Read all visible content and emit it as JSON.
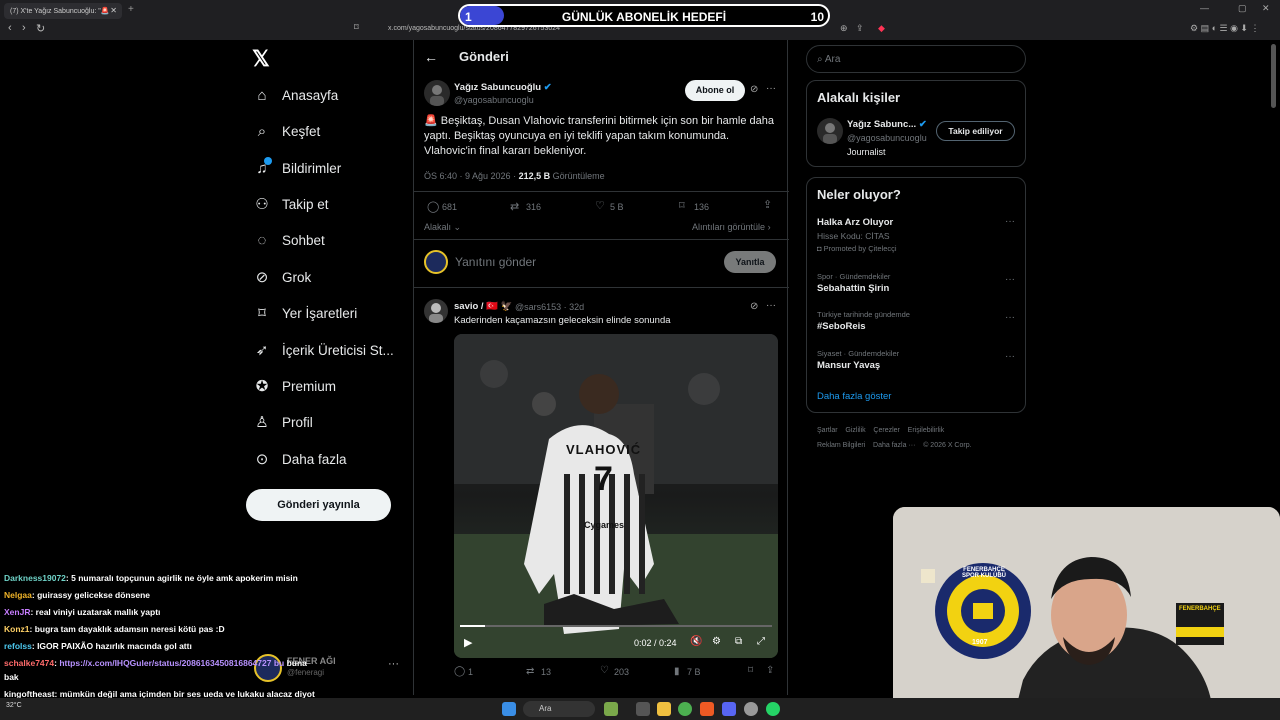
{
  "browser": {
    "tab_title": "(7) X'te Yağız Sabuncuoğlu: \"🚨",
    "url": "x.com/yagosabuncuoglu/status/2086477829726753024"
  },
  "overlay": {
    "goal_current": "1",
    "goal_title": "GÜNLÜK ABONELİK HEDEFİ",
    "goal_target": "10",
    "goal_progress": 0.1
  },
  "sidebar": {
    "items": [
      {
        "label": "Anasayfa",
        "icon": "home-icon"
      },
      {
        "label": "Keşfet",
        "icon": "search-icon"
      },
      {
        "label": "Bildirimler",
        "icon": "bell-icon"
      },
      {
        "label": "Takip et",
        "icon": "follow-icon"
      },
      {
        "label": "Sohbet",
        "icon": "chat-icon"
      },
      {
        "label": "Grok",
        "icon": "grok-icon"
      },
      {
        "label": "Yer İşaretleri",
        "icon": "bookmark-icon"
      },
      {
        "label": "İçerik Üreticisi St...",
        "icon": "rocket-icon"
      },
      {
        "label": "Premium",
        "icon": "verified-icon"
      },
      {
        "label": "Profil",
        "icon": "person-icon"
      },
      {
        "label": "Daha fazla",
        "icon": "more-icon"
      }
    ],
    "post_button": "Gönderi yayınla",
    "account_name": "FENER AĞI",
    "account_handle": "@feneragi"
  },
  "main": {
    "header": "Gönderi",
    "tweet": {
      "name": "Yağız Sabuncuoğlu",
      "handle": "@yagosabuncuoglu",
      "follow": "Abone ol",
      "text": "🚨 Beşiktaş, Dusan Vlahovic transferini bitirmek için son bir hamle daha yaptı. Beşiktaş oyuncuya en iyi teklifi yapan takım konumunda. Vlahovic'in final kararı bekleniyor.",
      "time": "ÖS 6:40 · 9 Ağu 2026 ·",
      "views": "212,5 B",
      "views_label": "Görüntüleme",
      "replies": "681",
      "reposts": "316",
      "likes": "5 B",
      "bookmarks": "136",
      "sort": "Alakalı",
      "quotes": "Alıntıları görüntüle"
    },
    "reply_box": {
      "placeholder": "Yanıtını gönder",
      "button": "Yanıtla"
    },
    "reply": {
      "name": "savio / 🇹🇷 🦅",
      "handle": "@sars6153 · 32d",
      "text": "Kaderinden kaçamazsın geleceksin elinde sonunda",
      "jersey_name": "VLAHOVIĆ",
      "jersey_number": "7",
      "sponsor": "Cygames",
      "video_time": "0:02 / 0:24",
      "video_progress": 0.08,
      "replies": "1",
      "reposts": "13",
      "likes": "203",
      "views": "7 B"
    }
  },
  "right": {
    "search_placeholder": "Ara",
    "related_title": "Alakalı kişiler",
    "person": {
      "name": "Yağız Sabunc...",
      "handle": "@yagosabuncuoglu",
      "bio": "Journalist",
      "button": "Takip ediliyor"
    },
    "trends_title": "Neler oluyor?",
    "trends": [
      {
        "cat": "",
        "name": "Halka Arz Oluyor",
        "sub": "Hisse Kodu: CİTAS",
        "promo": "Promoted by Çitelecçi"
      },
      {
        "cat": "Spor · Gündemdekiler",
        "name": "Sebahattin Şirin"
      },
      {
        "cat": "Türkiye tarihinde gündemde",
        "name": "#SeboReis"
      },
      {
        "cat": "Siyaset · Gündemdekiler",
        "name": "Mansur Yavaş"
      }
    ],
    "more": "Daha fazla göster",
    "footer1": [
      "Şartlar",
      "Gizlilik",
      "Çerezler",
      "Erişilebilirlik"
    ],
    "footer2": [
      "Reklam Bilgileri",
      "Daha fazla ···",
      "© 2026 X Corp."
    ]
  },
  "chat": [
    {
      "user": "Darkness19072",
      "color": "#6fd3c8",
      "msg": ": 5 numaralı topçunun agirlik ne öyle amk apokerim misin"
    },
    {
      "user": "Nelgaa",
      "color": "#f0b429",
      "msg": ": guirassy gelicekse dönsene"
    },
    {
      "user": "XenJR",
      "color": "#c77dff",
      "msg": ": real viniyi uzatarak mallık yaptı"
    },
    {
      "user": "Konz1",
      "color": "#ffd166",
      "msg": ": bugra tam dayaklık adamsın neresi kötü pas :D"
    },
    {
      "user": "refolss",
      "color": "#4cc9f0",
      "msg": ": IGOR PAIXÃO hazırlık macında gol attı"
    },
    {
      "user": "schalke7474",
      "color": "#ff6b6b",
      "msg": ": ",
      "link": "https://x.com/IHQGuler/status/2086163450816864727 bu",
      "tail": " buna"
    },
    {
      "user": "",
      "color": "#fff",
      "msg": "bak"
    },
    {
      "user": "kingoftheast",
      "color": "#fff",
      "msg": ": mümkün değil ama içimden bir ses ueda ve lukaku alacaz diyot"
    },
    {
      "user": "Kaifa619",
      "color": "#9ef01a",
      "msg": ": ardaya laf ediyo yakın :D"
    }
  ],
  "webcam": {
    "poster": "FENERBAHÇE",
    "crest": "FENERBAHÇE SPOR KULÜBÜ",
    "year": "1907"
  },
  "taskbar": {
    "search": "Ara",
    "weather": "32°C"
  }
}
